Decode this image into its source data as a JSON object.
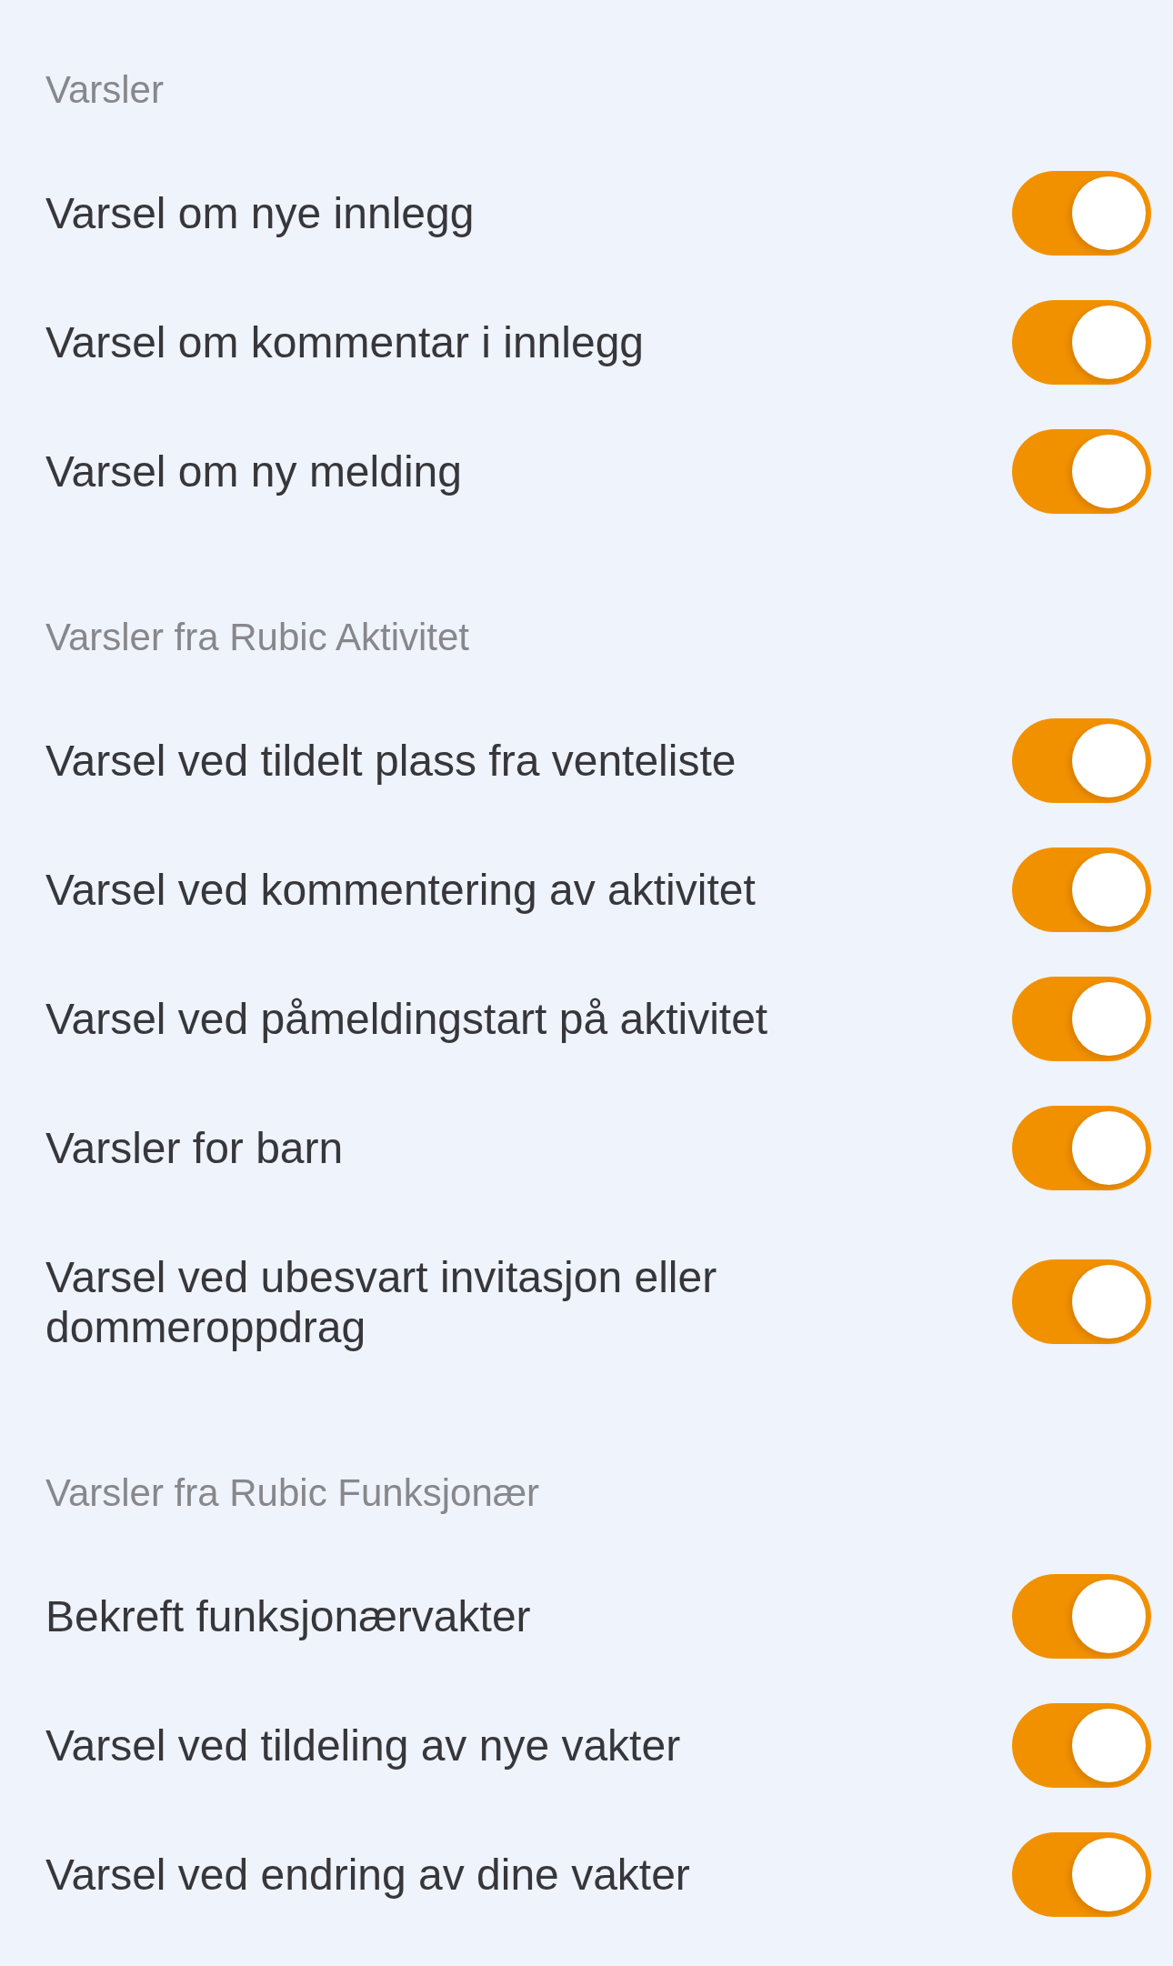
{
  "sections": [
    {
      "title": "Varsler",
      "items": [
        {
          "label": "Varsel om nye innlegg",
          "on": true
        },
        {
          "label": "Varsel om kommentar i innlegg",
          "on": true
        },
        {
          "label": "Varsel om ny melding",
          "on": true
        }
      ]
    },
    {
      "title": "Varsler fra Rubic Aktivitet",
      "items": [
        {
          "label": "Varsel ved tildelt plass fra venteliste",
          "on": true
        },
        {
          "label": "Varsel ved kommentering av aktivitet",
          "on": true
        },
        {
          "label": "Varsel ved påmeldingstart på aktivitet",
          "on": true
        },
        {
          "label": "Varsler for barn",
          "on": true
        },
        {
          "label": "Varsel ved ubesvart invitasjon eller dommeroppdrag",
          "on": true
        }
      ]
    },
    {
      "title": "Varsler fra Rubic Funksjonær",
      "items": [
        {
          "label": "Bekreft funksjonærvakter",
          "on": true
        },
        {
          "label": "Varsel ved tildeling av nye vakter",
          "on": true
        },
        {
          "label": "Varsel ved endring av dine vakter",
          "on": true
        }
      ]
    }
  ]
}
